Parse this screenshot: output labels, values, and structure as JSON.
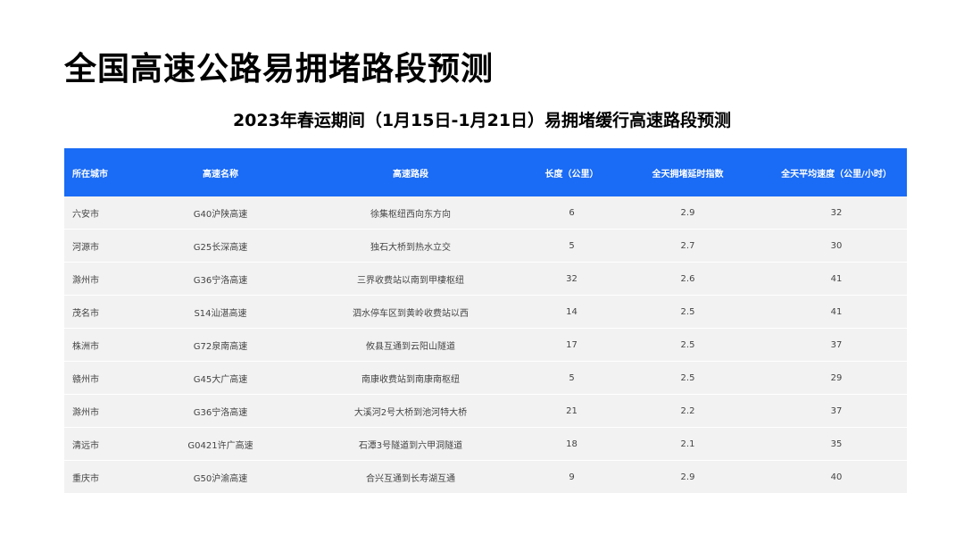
{
  "page": {
    "title": "全国高速公路易拥堵路段预测",
    "subtitle": "2023年春运期间（1月15日-1月21日）易拥堵缓行高速路段预测"
  },
  "table": {
    "headers": [
      "所在城市",
      "高速名称",
      "高速路段",
      "长度（公里）",
      "全天拥堵延时指数",
      "全天平均速度（公里/小时）"
    ],
    "rows": [
      [
        "六安市",
        "G40沪陕高速",
        "徐集枢纽西向东方向",
        "6",
        "2.9",
        "32"
      ],
      [
        "河源市",
        "G25长深高速",
        "独石大桥到热水立交",
        "5",
        "2.7",
        "30"
      ],
      [
        "滁州市",
        "G36宁洛高速",
        "三界收费站以南到甲棲枢纽",
        "32",
        "2.6",
        "41"
      ],
      [
        "茂名市",
        "S14汕湛高速",
        "泗水停车区到黄岭收费站以西",
        "14",
        "2.5",
        "41"
      ],
      [
        "株洲市",
        "G72泉南高速",
        "攸县互通到云阳山隧道",
        "17",
        "2.5",
        "37"
      ],
      [
        "赣州市",
        "G45大广高速",
        "南康收费站到南康南枢纽",
        "5",
        "2.5",
        "29"
      ],
      [
        "滁州市",
        "G36宁洛高速",
        "大溪河2号大桥到池河特大桥",
        "21",
        "2.2",
        "37"
      ],
      [
        "清远市",
        "G0421许广高速",
        "石潭3号隧道到六甲洞隧道",
        "18",
        "2.1",
        "35"
      ],
      [
        "重庆市",
        "G50沪渝高速",
        "合兴互通到长寿湖互通",
        "9",
        "2.9",
        "40"
      ]
    ]
  },
  "colors": {
    "header_bg": "#1a6bf5",
    "row_bg": "#f2f2f2"
  }
}
